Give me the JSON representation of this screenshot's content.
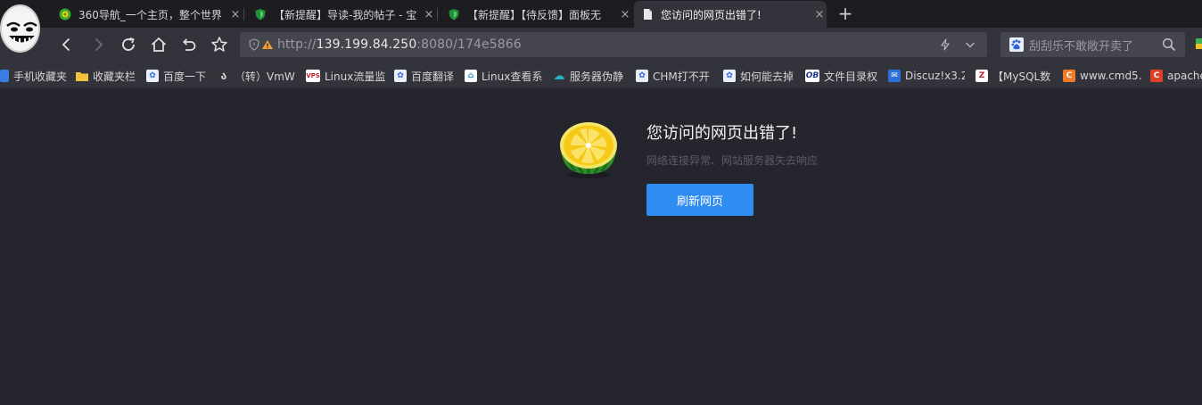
{
  "tabs": [
    {
      "title": "360导航_一个主页，整个世界",
      "close": "×",
      "favicon": "360-logo-icon",
      "active": false
    },
    {
      "title": "【新提醒】导读-我的帖子 - 宝",
      "close": "×",
      "favicon": "shield-icon",
      "active": false
    },
    {
      "title": "【新提醒】【待反馈】面板无",
      "close": "×",
      "favicon": "shield-icon",
      "active": false
    },
    {
      "title": "您访问的网页出错了!",
      "close": "×",
      "favicon": "page-icon",
      "active": true
    }
  ],
  "new_tab": "+",
  "address": {
    "scheme": "http://",
    "host": "139.199.84.250",
    "rest": ":8080/174e5866"
  },
  "search": {
    "placeholder": "刮刮乐不敢敞开卖了"
  },
  "bookmarks": [
    {
      "label": "手机收藏夹",
      "icon": "phone-icon"
    },
    {
      "label": "收藏夹栏",
      "icon": "folder-icon"
    },
    {
      "label": "百度一下",
      "icon": "baidu-paw-icon"
    },
    {
      "label": "（转）VmW",
      "icon": "vm-icon"
    },
    {
      "label": "Linux流量监",
      "icon": "vps-icon"
    },
    {
      "label": "百度翻译",
      "icon": "baidu-paw-icon"
    },
    {
      "label": "Linux查看系",
      "icon": "home-icon"
    },
    {
      "label": "服务器伪静",
      "icon": "cloud-icon"
    },
    {
      "label": "CHM打不开",
      "icon": "baidu-paw-icon"
    },
    {
      "label": "如何能去掉",
      "icon": "baidu-paw-icon"
    },
    {
      "label": "文件目录权",
      "icon": "ob-icon"
    },
    {
      "label": "Discuz!x3.2",
      "icon": "mail-icon"
    },
    {
      "label": "【MySQL数",
      "icon": "z-icon"
    },
    {
      "label": "www.cmd5.",
      "icon": "c-orange-icon"
    },
    {
      "label": "apache",
      "icon": "c-red-icon"
    }
  ],
  "error": {
    "title": "您访问的网页出错了!",
    "description": "网络连接异常、网站服务器失去响应",
    "button": "刷新网页"
  },
  "colors": {
    "background": "#25252d",
    "toolbar": "#33333b",
    "tabbar": "#1c1c21",
    "accent": "#2f8cf0"
  }
}
